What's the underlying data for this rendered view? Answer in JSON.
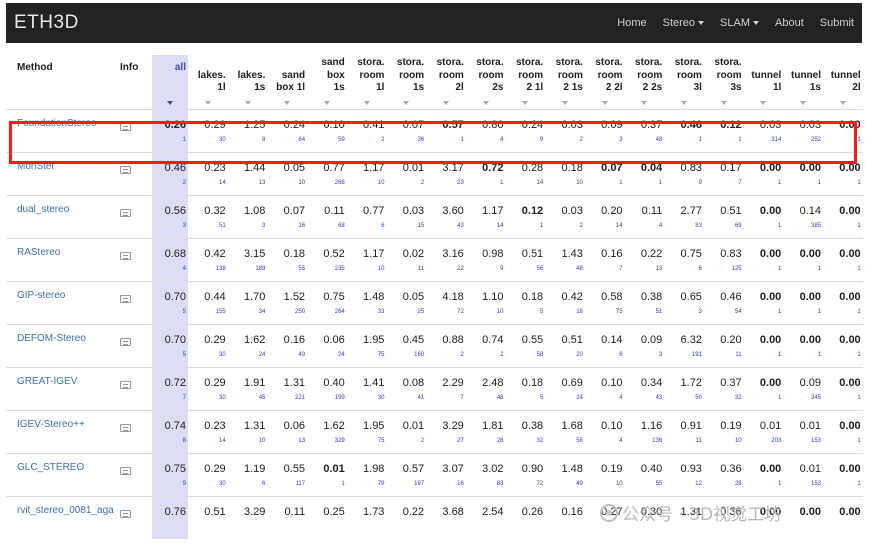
{
  "navbar": {
    "brand": "ETH3D",
    "items": [
      {
        "label": "Home",
        "dropdown": false
      },
      {
        "label": "Stereo",
        "dropdown": true
      },
      {
        "label": "SLAM",
        "dropdown": true
      },
      {
        "label": "About",
        "dropdown": false
      },
      {
        "label": "Submit",
        "dropdown": false
      }
    ]
  },
  "table": {
    "method_header": "Method",
    "info_header": "Info",
    "all_header": "all",
    "columns": [
      [
        "lakes.",
        "1l"
      ],
      [
        "lakes.",
        "1s"
      ],
      [
        "sand",
        "box 1l"
      ],
      [
        "sand",
        "box",
        "1s"
      ],
      [
        "stora.",
        "room",
        "1l"
      ],
      [
        "stora.",
        "room",
        "1s"
      ],
      [
        "stora.",
        "room",
        "2l"
      ],
      [
        "stora.",
        "room",
        "2s"
      ],
      [
        "stora.",
        "room",
        "2 1l"
      ],
      [
        "stora.",
        "room",
        "2 1s"
      ],
      [
        "stora.",
        "room",
        "2 2l"
      ],
      [
        "stora.",
        "room",
        "2 2s"
      ],
      [
        "stora.",
        "room",
        "3l"
      ],
      [
        "stora.",
        "room",
        "3s"
      ],
      [
        "tunnel",
        "1l"
      ],
      [
        "tunnel",
        "1s"
      ],
      [
        "tunnel",
        "2l"
      ]
    ],
    "rows": [
      {
        "method": "FoundationStereo",
        "all": "0.26",
        "all_rank": "1",
        "all_bold": true,
        "cells": [
          [
            "0.29",
            "30",
            false
          ],
          [
            "1.25",
            "8",
            false
          ],
          [
            "0.24",
            "64",
            false
          ],
          [
            "0.10",
            "59",
            false
          ],
          [
            "0.41",
            "2",
            false
          ],
          [
            "0.07",
            "36",
            false
          ],
          [
            "0.57",
            "1",
            true
          ],
          [
            "0.80",
            "4",
            false
          ],
          [
            "0.24",
            "9",
            false
          ],
          [
            "0.03",
            "2",
            false
          ],
          [
            "0.09",
            "3",
            false
          ],
          [
            "0.37",
            "48",
            false
          ],
          [
            "0.46",
            "1",
            true
          ],
          [
            "0.12",
            "1",
            true
          ],
          [
            "0.03",
            "314",
            false
          ],
          [
            "0.03",
            "252",
            false
          ],
          [
            "0.00",
            "1",
            true
          ]
        ]
      },
      {
        "method": "MonSter",
        "all": "0.46",
        "all_rank": "2",
        "all_bold": false,
        "cells": [
          [
            "0.23",
            "14",
            false
          ],
          [
            "1.44",
            "13",
            false
          ],
          [
            "0.05",
            "10",
            false
          ],
          [
            "0.77",
            "268",
            false
          ],
          [
            "1.17",
            "10",
            false
          ],
          [
            "0.01",
            "2",
            false
          ],
          [
            "3.17",
            "23",
            false
          ],
          [
            "0.72",
            "1",
            true
          ],
          [
            "0.28",
            "14",
            false
          ],
          [
            "0.18",
            "10",
            false
          ],
          [
            "0.07",
            "1",
            true
          ],
          [
            "0.04",
            "1",
            true
          ],
          [
            "0.83",
            "9",
            false
          ],
          [
            "0.17",
            "7",
            false
          ],
          [
            "0.00",
            "1",
            true
          ],
          [
            "0.00",
            "1",
            true
          ],
          [
            "0.00",
            "1",
            true
          ]
        ]
      },
      {
        "method": "dual_stereo",
        "all": "0.56",
        "all_rank": "3",
        "all_bold": false,
        "cells": [
          [
            "0.32",
            "51",
            false
          ],
          [
            "1.08",
            "3",
            false
          ],
          [
            "0.07",
            "16",
            false
          ],
          [
            "0.11",
            "68",
            false
          ],
          [
            "0.77",
            "6",
            false
          ],
          [
            "0.03",
            "15",
            false
          ],
          [
            "3.60",
            "43",
            false
          ],
          [
            "1.17",
            "14",
            false
          ],
          [
            "0.12",
            "1",
            true
          ],
          [
            "0.03",
            "2",
            false
          ],
          [
            "0.20",
            "14",
            false
          ],
          [
            "0.11",
            "4",
            false
          ],
          [
            "2.77",
            "83",
            false
          ],
          [
            "0.51",
            "69",
            false
          ],
          [
            "0.00",
            "1",
            true
          ],
          [
            "0.14",
            "385",
            false
          ],
          [
            "0.00",
            "1",
            true
          ]
        ]
      },
      {
        "method": "RAStereo",
        "all": "0.68",
        "all_rank": "4",
        "all_bold": false,
        "cells": [
          [
            "0.42",
            "138",
            false
          ],
          [
            "3.15",
            "189",
            false
          ],
          [
            "0.18",
            "55",
            false
          ],
          [
            "0.52",
            "235",
            false
          ],
          [
            "1.17",
            "10",
            false
          ],
          [
            "0.02",
            "11",
            false
          ],
          [
            "3.16",
            "22",
            false
          ],
          [
            "0.98",
            "9",
            false
          ],
          [
            "0.51",
            "56",
            false
          ],
          [
            "1.43",
            "48",
            false
          ],
          [
            "0.16",
            "7",
            false
          ],
          [
            "0.22",
            "13",
            false
          ],
          [
            "0.75",
            "6",
            false
          ],
          [
            "0.83",
            "125",
            false
          ],
          [
            "0.00",
            "1",
            true
          ],
          [
            "0.00",
            "1",
            true
          ],
          [
            "0.00",
            "1",
            true
          ]
        ]
      },
      {
        "method": "GIP-stereo",
        "all": "0.70",
        "all_rank": "5",
        "all_bold": false,
        "cells": [
          [
            "0.44",
            "155",
            false
          ],
          [
            "1.70",
            "34",
            false
          ],
          [
            "1.52",
            "250",
            false
          ],
          [
            "0.75",
            "264",
            false
          ],
          [
            "1.48",
            "33",
            false
          ],
          [
            "0.05",
            "25",
            false
          ],
          [
            "4.18",
            "72",
            false
          ],
          [
            "1.10",
            "10",
            false
          ],
          [
            "0.18",
            "5",
            false
          ],
          [
            "0.42",
            "18",
            false
          ],
          [
            "0.58",
            "75",
            false
          ],
          [
            "0.38",
            "51",
            false
          ],
          [
            "0.65",
            "3",
            false
          ],
          [
            "0.46",
            "54",
            false
          ],
          [
            "0.00",
            "1",
            true
          ],
          [
            "0.00",
            "1",
            true
          ],
          [
            "0.00",
            "1",
            true
          ]
        ]
      },
      {
        "method": "DEFOM-Stereo",
        "all": "0.70",
        "all_rank": "5",
        "all_bold": false,
        "cells": [
          [
            "0.29",
            "30",
            false
          ],
          [
            "1.62",
            "24",
            false
          ],
          [
            "0.16",
            "49",
            false
          ],
          [
            "0.06",
            "24",
            false
          ],
          [
            "1.95",
            "75",
            false
          ],
          [
            "0.45",
            "160",
            false
          ],
          [
            "0.88",
            "2",
            false
          ],
          [
            "0.74",
            "2",
            false
          ],
          [
            "0.55",
            "58",
            false
          ],
          [
            "0.51",
            "20",
            false
          ],
          [
            "0.14",
            "6",
            false
          ],
          [
            "0.09",
            "3",
            false
          ],
          [
            "6.32",
            "191",
            false
          ],
          [
            "0.20",
            "11",
            false
          ],
          [
            "0.00",
            "1",
            true
          ],
          [
            "0.00",
            "1",
            true
          ],
          [
            "0.00",
            "1",
            true
          ]
        ]
      },
      {
        "method": "GREAT-IGEV",
        "all": "0.72",
        "all_rank": "7",
        "all_bold": false,
        "cells": [
          [
            "0.29",
            "30",
            false
          ],
          [
            "1.91",
            "45",
            false
          ],
          [
            "1.31",
            "221",
            false
          ],
          [
            "0.40",
            "199",
            false
          ],
          [
            "1.41",
            "30",
            false
          ],
          [
            "0.08",
            "41",
            false
          ],
          [
            "2.29",
            "7",
            false
          ],
          [
            "2.48",
            "48",
            false
          ],
          [
            "0.18",
            "5",
            false
          ],
          [
            "0.69",
            "24",
            false
          ],
          [
            "0.10",
            "4",
            false
          ],
          [
            "0.34",
            "43",
            false
          ],
          [
            "1.72",
            "50",
            false
          ],
          [
            "0.37",
            "32",
            false
          ],
          [
            "0.00",
            "1",
            true
          ],
          [
            "0.09",
            "345",
            false
          ],
          [
            "0.00",
            "1",
            true
          ]
        ]
      },
      {
        "method": "IGEV-Stereo++",
        "all": "0.74",
        "all_rank": "8",
        "all_bold": false,
        "cells": [
          [
            "0.23",
            "14",
            false
          ],
          [
            "1.31",
            "10",
            false
          ],
          [
            "0.06",
            "13",
            false
          ],
          [
            "1.62",
            "329",
            false
          ],
          [
            "1.95",
            "75",
            false
          ],
          [
            "0.01",
            "2",
            false
          ],
          [
            "3.29",
            "27",
            false
          ],
          [
            "1.81",
            "28",
            false
          ],
          [
            "0.38",
            "32",
            false
          ],
          [
            "1.68",
            "58",
            false
          ],
          [
            "0.10",
            "4",
            false
          ],
          [
            "1.16",
            "136",
            false
          ],
          [
            "0.91",
            "11",
            false
          ],
          [
            "0.19",
            "10",
            false
          ],
          [
            "0.01",
            "203",
            false
          ],
          [
            "0.01",
            "153",
            false
          ],
          [
            "0.00",
            "1",
            true
          ]
        ]
      },
      {
        "method": "GLC_STEREO",
        "all": "0.75",
        "all_rank": "9",
        "all_bold": false,
        "cells": [
          [
            "0.29",
            "30",
            false
          ],
          [
            "1.19",
            "6",
            false
          ],
          [
            "0.55",
            "117",
            false
          ],
          [
            "0.01",
            "1",
            true
          ],
          [
            "1.98",
            "79",
            false
          ],
          [
            "0.57",
            "197",
            false
          ],
          [
            "3.07",
            "16",
            false
          ],
          [
            "3.02",
            "83",
            false
          ],
          [
            "0.90",
            "72",
            false
          ],
          [
            "1.48",
            "49",
            false
          ],
          [
            "0.19",
            "10",
            false
          ],
          [
            "0.40",
            "55",
            false
          ],
          [
            "0.93",
            "12",
            false
          ],
          [
            "0.36",
            "28",
            false
          ],
          [
            "0.00",
            "1",
            true
          ],
          [
            "0.01",
            "153",
            false
          ],
          [
            "0.00",
            "1",
            true
          ]
        ]
      },
      {
        "method": "rvit_stereo_0081_aga",
        "all": "0.76",
        "all_rank": "",
        "all_bold": false,
        "cells": [
          [
            "0.51",
            "",
            false
          ],
          [
            "3.29",
            "",
            false
          ],
          [
            "0.11",
            "",
            false
          ],
          [
            "0.25",
            "",
            false
          ],
          [
            "1.73",
            "",
            false
          ],
          [
            "0.22",
            "",
            false
          ],
          [
            "3.68",
            "",
            false
          ],
          [
            "2.54",
            "",
            false
          ],
          [
            "0.26",
            "",
            false
          ],
          [
            "0.16",
            "",
            false
          ],
          [
            "0.27",
            "",
            false
          ],
          [
            "0.30",
            "",
            false
          ],
          [
            "1.31",
            "",
            false
          ],
          [
            "0.36",
            "",
            false
          ],
          [
            "0.00",
            "",
            true
          ],
          [
            "0.00",
            "",
            true
          ],
          [
            "0.00",
            "",
            true
          ]
        ]
      }
    ]
  },
  "watermark": {
    "text": "公众号 · 3D视觉工坊"
  },
  "icons": {
    "info": "document-icon"
  },
  "colors": {
    "highlight": "#ff1a1a",
    "rank": "#2b3fc2",
    "link": "#3d6fb3",
    "all_column_bg": "#dcdcf5"
  }
}
